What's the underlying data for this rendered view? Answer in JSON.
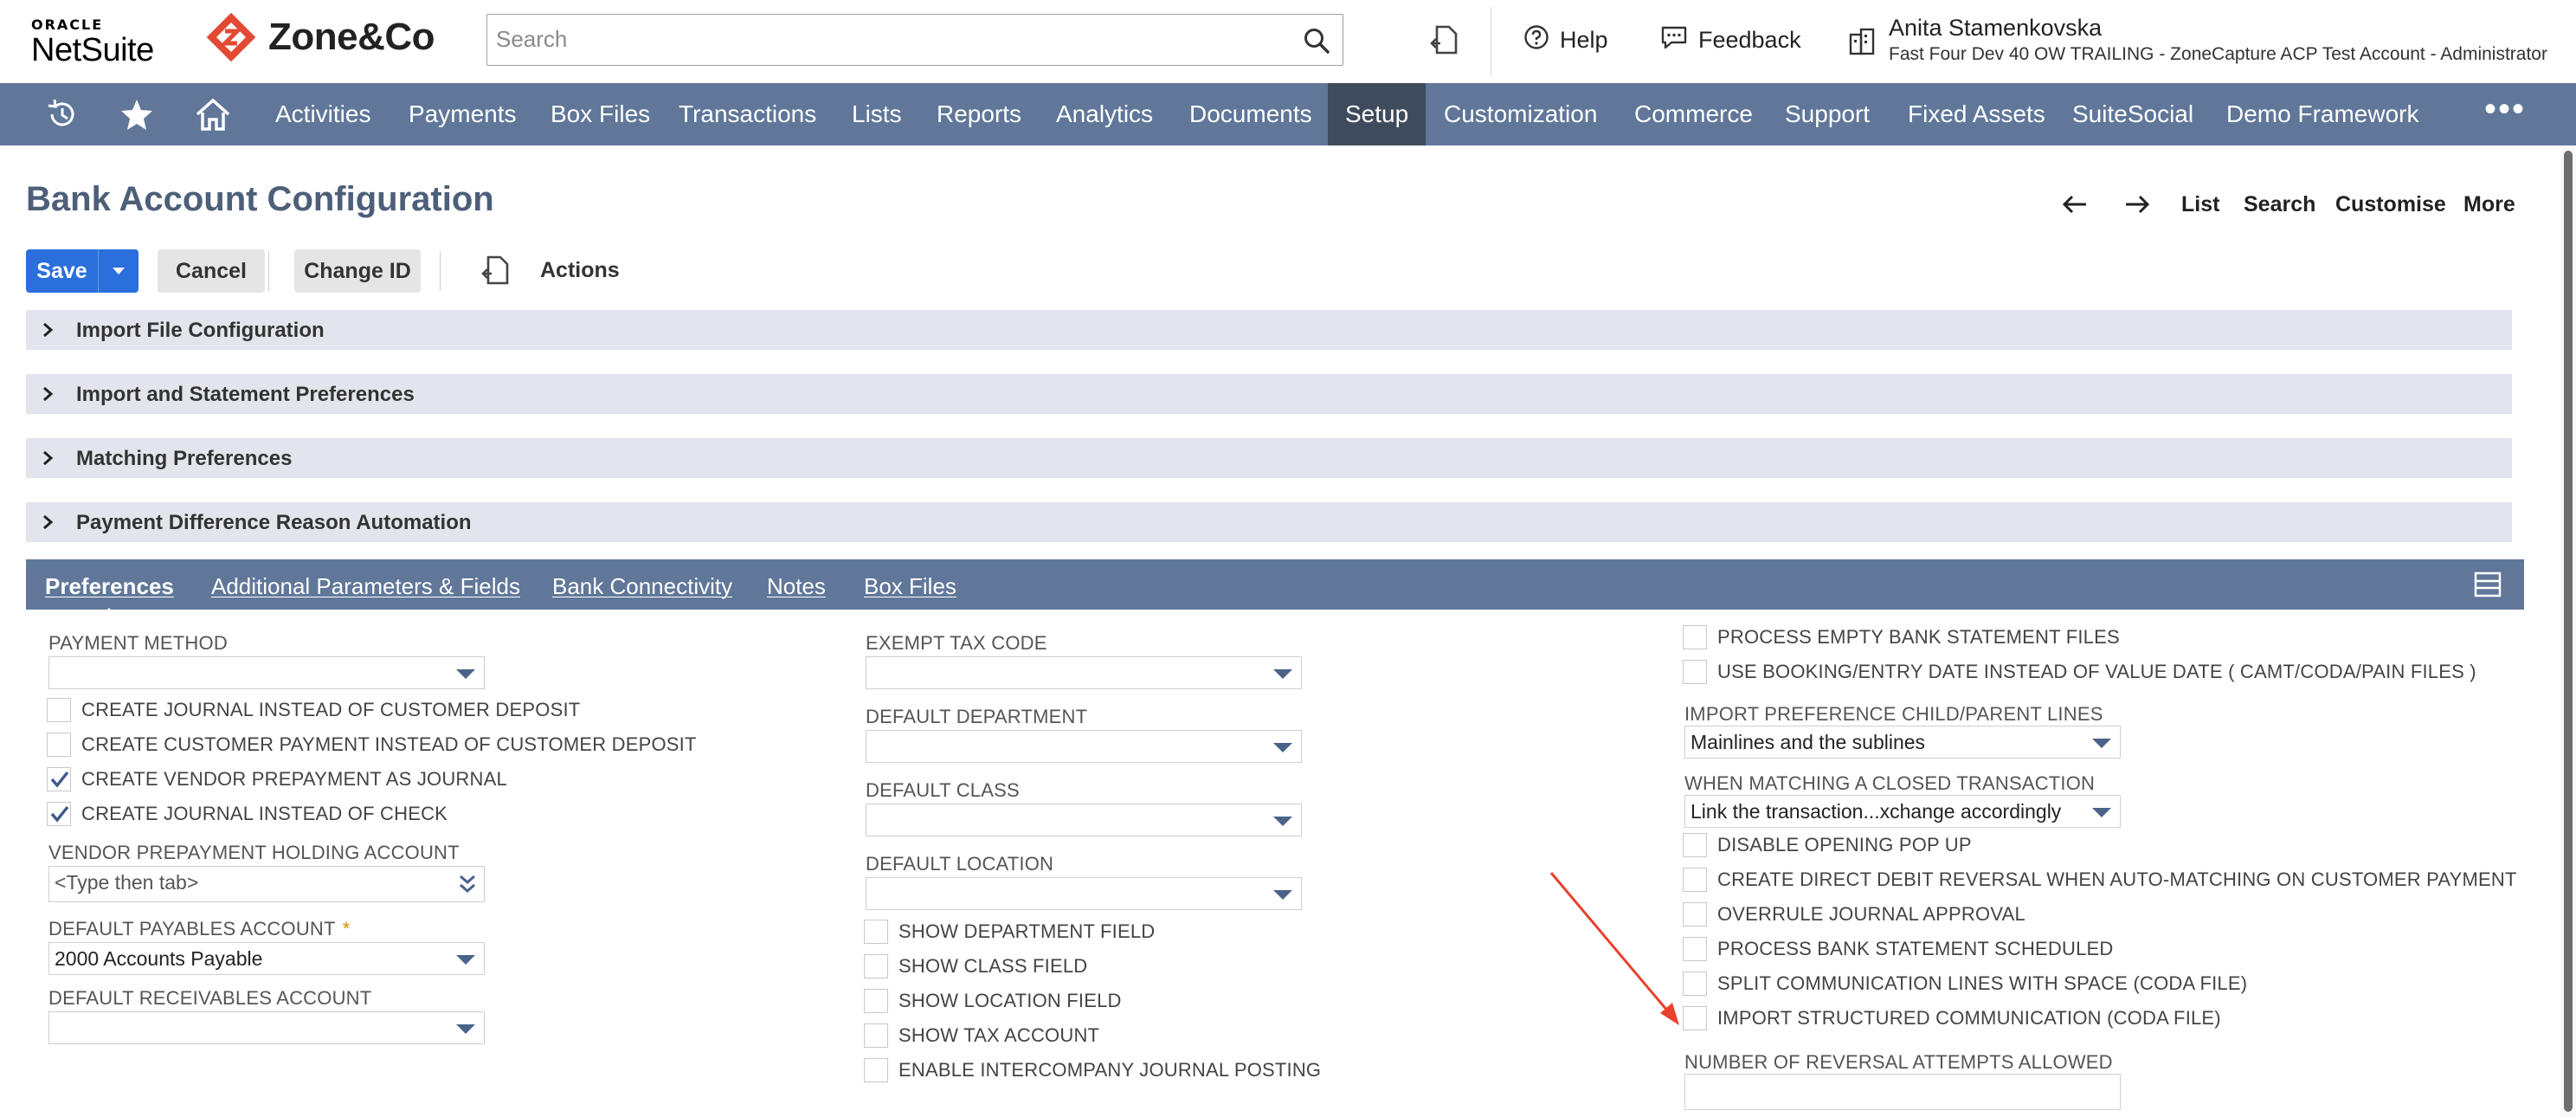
{
  "header": {
    "oracle_small": "ORACLE",
    "oracle_big": "NetSuite",
    "brand": "Zone&Co",
    "search_placeholder": "Search",
    "help_label": "Help",
    "feedback_label": "Feedback",
    "user_name": "Anita Stamenkovska",
    "user_account": "Fast Four Dev 40 OW TRAILING - ZoneCapture ACP Test Account - Administrator"
  },
  "nav": {
    "items": [
      "Activities",
      "Payments",
      "Box Files",
      "Transactions",
      "Lists",
      "Reports",
      "Analytics",
      "Documents",
      "Setup",
      "Customization",
      "Commerce",
      "Support",
      "Fixed Assets",
      "SuiteSocial",
      "Demo Framework"
    ],
    "active": "Setup",
    "more": "•••"
  },
  "page": {
    "title": "Bank Account Configuration",
    "tools": {
      "list": "List",
      "search": "Search",
      "customise": "Customise",
      "more": "More"
    }
  },
  "buttons": {
    "save": "Save",
    "cancel": "Cancel",
    "change_id": "Change ID",
    "actions": "Actions"
  },
  "sections": [
    "Import File Configuration",
    "Import and Statement Preferences",
    "Matching Preferences",
    "Payment Difference Reason Automation"
  ],
  "tabs": [
    "Preferences",
    "Additional Parameters & Fields",
    "Bank Connectivity",
    "Notes",
    "Box Files"
  ],
  "col1": {
    "payment_method_label": "PAYMENT METHOD",
    "cb_journal_customer_deposit": "CREATE JOURNAL INSTEAD OF CUSTOMER DEPOSIT",
    "cb_customer_payment": "CREATE CUSTOMER PAYMENT INSTEAD OF CUSTOMER DEPOSIT",
    "cb_vendor_prepayment": "CREATE VENDOR PREPAYMENT AS JOURNAL",
    "cb_journal_check": "CREATE JOURNAL INSTEAD OF CHECK",
    "vendor_holding_label": "VENDOR PREPAYMENT HOLDING ACCOUNT",
    "vendor_holding_placeholder": "<Type then tab>",
    "payables_label": "DEFAULT PAYABLES ACCOUNT",
    "required_mark": "*",
    "payables_value": "2000 Accounts Payable",
    "receivables_label": "DEFAULT RECEIVABLES ACCOUNT"
  },
  "col2": {
    "exempt_tax_label": "EXEMPT TAX CODE",
    "department_label": "DEFAULT DEPARTMENT",
    "class_label": "DEFAULT CLASS",
    "location_label": "DEFAULT LOCATION",
    "cb_show_department": "SHOW DEPARTMENT FIELD",
    "cb_show_class": "SHOW CLASS FIELD",
    "cb_show_location": "SHOW LOCATION FIELD",
    "cb_show_tax": "SHOW TAX ACCOUNT",
    "cb_intercompany": "ENABLE INTERCOMPANY JOURNAL POSTING"
  },
  "col3": {
    "cb_process_empty": "PROCESS EMPTY BANK STATEMENT FILES",
    "cb_booking_date": "USE BOOKING/ENTRY DATE INSTEAD OF VALUE DATE ( CAMT/CODA/PAIN FILES )",
    "child_parent_label": "IMPORT PREFERENCE CHILD/PARENT LINES",
    "child_parent_value": "Mainlines and the sublines",
    "closed_txn_label": "WHEN MATCHING A CLOSED TRANSACTION",
    "closed_txn_value": "Link the transaction...xchange accordingly",
    "cb_disable_popup": "DISABLE OPENING POP UP",
    "cb_direct_debit": "CREATE DIRECT DEBIT REVERSAL WHEN AUTO-MATCHING ON CUSTOMER PAYMENT",
    "cb_overrule": "OVERRULE JOURNAL APPROVAL",
    "cb_scheduled": "PROCESS BANK STATEMENT SCHEDULED",
    "cb_split": "SPLIT COMMUNICATION LINES WITH SPACE (CODA FILE)",
    "cb_structured": "IMPORT STRUCTURED COMMUNICATION (CODA FILE)",
    "reversal_label": "NUMBER OF REVERSAL ATTEMPTS ALLOWED"
  },
  "colors": {
    "nav_bg": "#607799",
    "nav_active": "#3e4b5c",
    "save_blue": "#2a6fdb",
    "title_color": "#4d5f79",
    "annotation_red": "#e8412c",
    "brand_red": "#e24a33"
  },
  "icons": [
    "search-icon",
    "recent-records-icon",
    "help-icon",
    "feedback-icon",
    "role-switch-icon",
    "history-icon",
    "star-icon",
    "home-icon",
    "arrow-left-icon",
    "arrow-right-icon",
    "chevron-right-icon",
    "checkmark-icon",
    "dropdown-arrow-icon",
    "tab-menu-icon"
  ]
}
